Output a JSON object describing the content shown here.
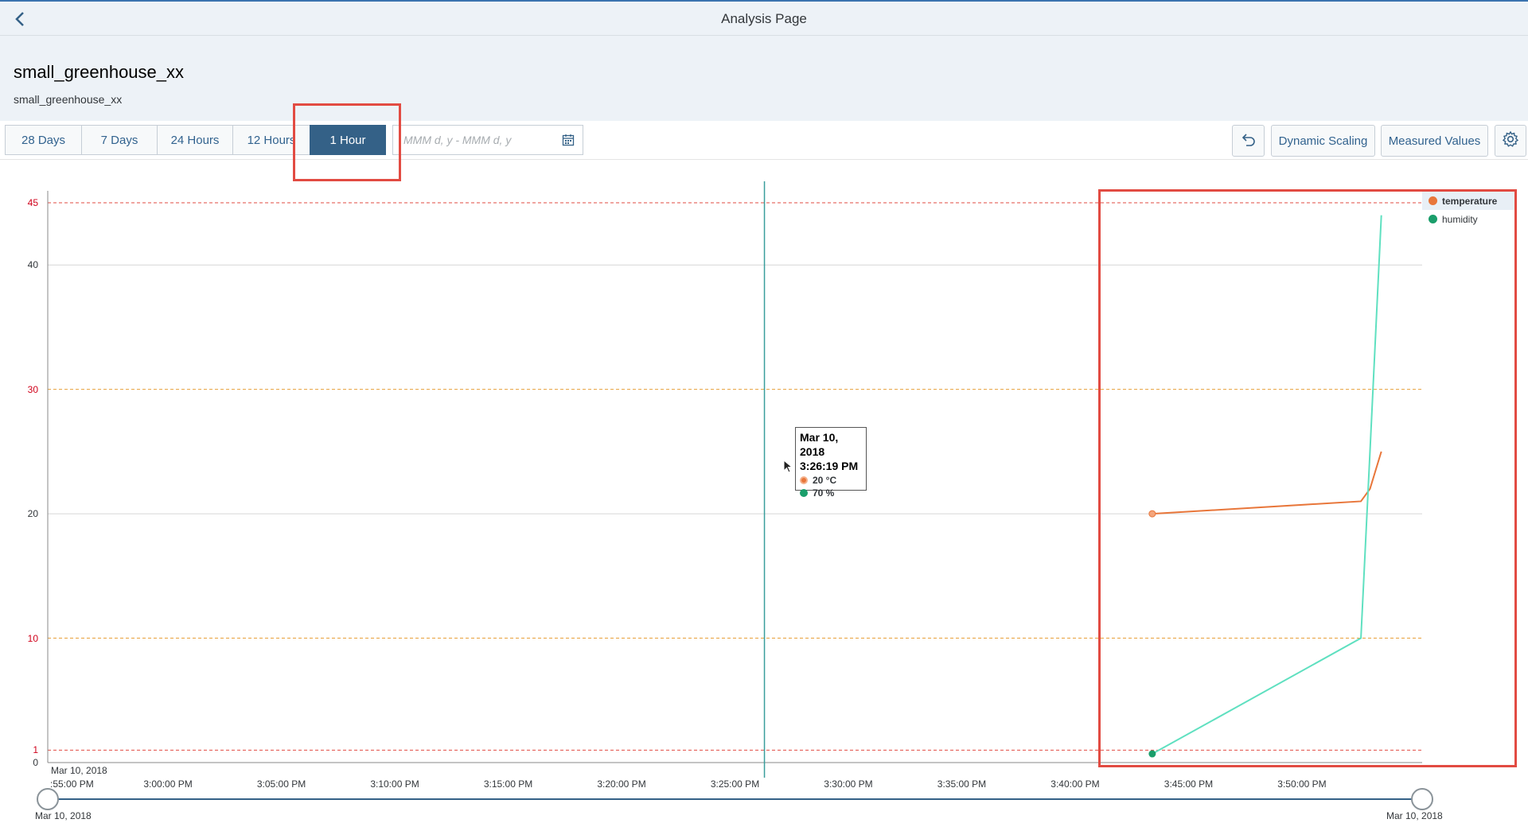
{
  "app": {
    "title": "Analysis Page"
  },
  "header": {
    "title": "small_greenhouse_xx",
    "subtitle": "small_greenhouse_xx"
  },
  "toolbar": {
    "ranges": [
      "28 Days",
      "7 Days",
      "24 Hours",
      "12 Hours",
      "1 Hour"
    ],
    "selected_range": "1 Hour",
    "date_placeholder": "MMM d, y - MMM d, y",
    "dynamic_scaling_label": "Dynamic Scaling",
    "measured_values_label": "Measured Values"
  },
  "chart": {
    "y_unit_label": "°C",
    "x_start_date": "Mar 10, 2018",
    "range_start_label": "Mar 10, 2018",
    "range_end_label": "Mar 10, 2018",
    "legend": [
      {
        "name": "temperature",
        "color": "#e8763a"
      },
      {
        "name": "humidity",
        "color": "#1a9e6b"
      }
    ],
    "tooltip": {
      "date": "Mar 10, 2018",
      "time": "3:26:19 PM",
      "temperature": "20 °C",
      "humidity": "70 %"
    }
  },
  "chart_data": {
    "type": "line",
    "ylabel": "°C",
    "ylim": [
      0,
      46
    ],
    "yticks": [
      "0",
      "1",
      "10",
      "20",
      "30",
      "40",
      "45"
    ],
    "xticks": [
      ":55:00 PM",
      "3:00:00 PM",
      "3:05:00 PM",
      "3:10:00 PM",
      "3:15:00 PM",
      "3:20:00 PM",
      "3:25:00 PM",
      "3:30:00 PM",
      "3:35:00 PM",
      "3:40:00 PM",
      "3:45:00 PM",
      "3:50:00 PM"
    ],
    "xlim_minutes": [
      -5.3,
      55.3
    ],
    "threshold_lines": [
      {
        "value": 45,
        "color": "#e24b42"
      },
      {
        "value": 30,
        "color": "#e8a03a"
      },
      {
        "value": 10,
        "color": "#e8a03a"
      },
      {
        "value": 1,
        "color": "#e24b42"
      }
    ],
    "cursor_time": "3:26:19 PM",
    "cursor_minute": 26.3,
    "series": [
      {
        "name": "temperature",
        "color": "#e8763a",
        "points": [
          [
            43.4,
            20
          ],
          [
            52.6,
            21
          ],
          [
            53.0,
            22
          ],
          [
            53.5,
            25
          ]
        ]
      },
      {
        "name": "humidity",
        "color": "#5fe0c0",
        "points": [
          [
            43.4,
            0.7
          ],
          [
            52.6,
            10
          ],
          [
            53.0,
            25
          ],
          [
            53.5,
            44
          ]
        ]
      }
    ]
  }
}
